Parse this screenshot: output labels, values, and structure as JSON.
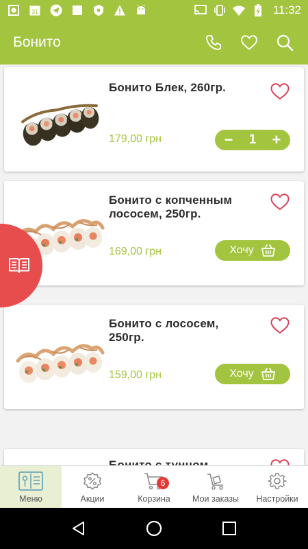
{
  "status_bar": {
    "time": "11:32",
    "calendar_day": "31",
    "icons": [
      "record-icon",
      "calendar-icon",
      "telegram-icon",
      "square-icon",
      "shield-icon",
      "warning-icon",
      "android-icon",
      "cast-icon",
      "vibrate-icon",
      "wifi-icon",
      "battery-charging-icon"
    ]
  },
  "app_bar": {
    "title": "Бонито",
    "actions": [
      "phone-icon",
      "heart-icon",
      "search-icon"
    ]
  },
  "products": [
    {
      "title": "Бонито Блек, 260гр.",
      "price": "179,00 грн",
      "action": "stepper",
      "quantity": "1",
      "image": "dark-rolls"
    },
    {
      "title": "Бонито с копченным лососем, 250гр.",
      "price": "169,00 грн",
      "action": "want",
      "button_label": "Хочу",
      "image": "salmon-rolls"
    },
    {
      "title": "Бонито с лососем, 250гр.",
      "price": "159,00 грн",
      "action": "want",
      "button_label": "Хочу",
      "image": "salmon-rolls"
    },
    {
      "title": "Бонито с тунцом",
      "image": "tuna-rolls"
    }
  ],
  "stepper": {
    "minus": "−",
    "plus": "+"
  },
  "side_tab_icon": "menu-book-icon",
  "bottom_nav": [
    {
      "label": "Меню",
      "icon": "menu-book-icon",
      "active": true
    },
    {
      "label": "Акции",
      "icon": "discount-icon"
    },
    {
      "label": "Корзина",
      "icon": "cart-icon",
      "badge": "6"
    },
    {
      "label": "Мои заказы",
      "icon": "trolley-icon"
    },
    {
      "label": "Настройки",
      "icon": "gear-icon"
    }
  ],
  "colors": {
    "brand_green": "#a3c43f",
    "heart_red": "#d9435a",
    "side_tab_red": "#e84d4d",
    "badge_red": "#e53935"
  }
}
